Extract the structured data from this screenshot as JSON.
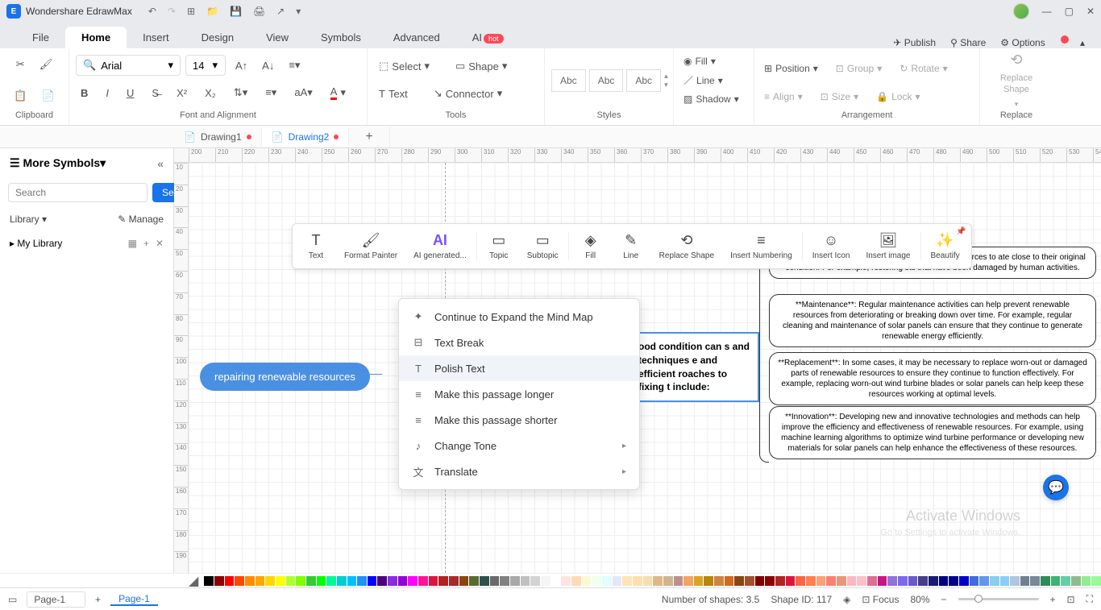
{
  "title": "Wondershare EdrawMax",
  "menu": {
    "file": "File",
    "home": "Home",
    "insert": "Insert",
    "design": "Design",
    "view": "View",
    "symbols": "Symbols",
    "advanced": "Advanced",
    "ai": "AI",
    "ai_badge": "hot"
  },
  "topright": {
    "publish": "Publish",
    "share": "Share",
    "options": "Options"
  },
  "ribbon": {
    "clipboard": "Clipboard",
    "font_name": "Arial",
    "font_size": "14",
    "fontalign": "Font and Alignment",
    "select": "Select",
    "shape": "Shape",
    "text": "Text",
    "connector": "Connector",
    "tools": "Tools",
    "abc": "Abc",
    "styles": "Styles",
    "fill": "Fill",
    "line": "Line",
    "shadow": "Shadow",
    "position": "Position",
    "align": "Align",
    "group": "Group",
    "size": "Size",
    "rotate": "Rotate",
    "lock": "Lock",
    "arrangement": "Arrangement",
    "replace_shape": "Replace Shape",
    "replace": "Replace"
  },
  "doctabs": {
    "d1": "Drawing1",
    "d2": "Drawing2"
  },
  "sidebar": {
    "more": "More Symbols",
    "search_ph": "Search",
    "search_btn": "Search",
    "library": "Library",
    "manage": "Manage",
    "mylib": "My Library"
  },
  "float": {
    "text": "Text",
    "format": "Format Painter",
    "ai": "AI generated...",
    "topic": "Topic",
    "subtopic": "Subtopic",
    "fill": "Fill",
    "line": "Line",
    "replace": "Replace Shape",
    "numbering": "Insert Numbering",
    "icon": "Insert Icon",
    "image": "Insert image",
    "beautify": "Beautify"
  },
  "menu_items": {
    "expand": "Continue to Expand the Mind Map",
    "tbreak": "Text Break",
    "polish": "Polish Text",
    "longer": "Make this passage longer",
    "shorter": "Make this passage shorter",
    "tone": "Change Tone",
    "translate": "Translate"
  },
  "nodes": {
    "main": "repairing renewable resources",
    "t1": "ood condition can s and techniques e and efficient roaches to fixing t include:",
    "b1": "olves reviving damaged or degraded renewable resources to ate close to their original condition. For example, restoring sts that have been damaged by human activities.",
    "b2": "**Maintenance**: Regular maintenance activities can help prevent renewable resources from deteriorating or breaking down over time. For example, regular cleaning and maintenance of solar panels can ensure that they continue to generate renewable energy efficiently.",
    "b3": "**Replacement**: In some cases, it may be necessary to replace worn-out or damaged parts of renewable resources to ensure they continue to function effectively. For example, replacing worn-out wind turbine blades or solar panels can help keep these resources working at optimal levels.",
    "b4": "**Innovation**: Developing new and innovative technologies and methods can help improve the efficiency and effectiveness of renewable resources. For example, using machine learning algorithms to optimize wind turbine performance or developing new materials for solar panels can help enhance the effectiveness of these resources."
  },
  "status": {
    "page_sel": "Page-1",
    "page_tab": "Page-1",
    "shapes": "Number of shapes: 3.5",
    "shapeid": "Shape ID: 117",
    "focus": "Focus",
    "zoom": "80%"
  },
  "watermark": "Activate Windows",
  "watermark2": "Go to Settings to activate Windows.",
  "colors": [
    "#000000",
    "#8b0000",
    "#ff0000",
    "#ff4500",
    "#ff8c00",
    "#ffa500",
    "#ffd700",
    "#ffff00",
    "#adff2f",
    "#7fff00",
    "#32cd32",
    "#00ff00",
    "#00fa9a",
    "#00ced1",
    "#00bfff",
    "#1e90ff",
    "#0000ff",
    "#4b0082",
    "#8a2be2",
    "#9400d3",
    "#ff00ff",
    "#ff1493",
    "#dc143c",
    "#b22222",
    "#a52a2a",
    "#8b4513",
    "#556b2f",
    "#2f4f4f",
    "#696969",
    "#808080",
    "#a9a9a9",
    "#c0c0c0",
    "#d3d3d3",
    "#f5f5f5",
    "#ffffff",
    "#ffe4e1",
    "#ffdab9",
    "#fafad2",
    "#f0fff0",
    "#e0ffff",
    "#e6e6fa",
    "#ffe4b5",
    "#ffdead",
    "#f5deb3",
    "#deb887",
    "#d2b48c",
    "#bc8f8f",
    "#f4a460",
    "#daa520",
    "#b8860b",
    "#cd853f",
    "#d2691e",
    "#8b4513",
    "#a0522d",
    "#800000",
    "#8b0000",
    "#b22222",
    "#dc143c",
    "#ff6347",
    "#ff7f50",
    "#ffa07a",
    "#fa8072",
    "#e9967a",
    "#ffb6c1",
    "#ffc0cb",
    "#db7093",
    "#c71585",
    "#9370db",
    "#7b68ee",
    "#6a5acd",
    "#483d8b",
    "#191970",
    "#000080",
    "#00008b",
    "#0000cd",
    "#4169e1",
    "#6495ed",
    "#87ceeb",
    "#87cefa",
    "#b0c4de",
    "#708090",
    "#778899",
    "#2e8b57",
    "#3cb371",
    "#66cdaa",
    "#8fbc8f",
    "#90ee90",
    "#98fb98"
  ]
}
